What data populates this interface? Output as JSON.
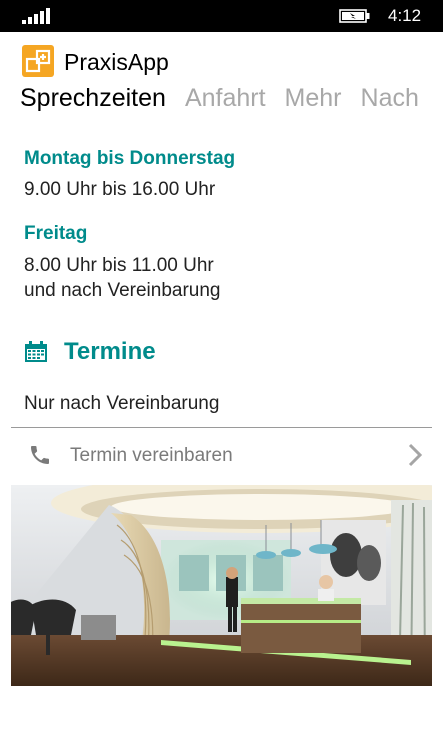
{
  "status_bar": {
    "time": "4:12",
    "signal_icon": "signal-strength-icon",
    "battery_icon": "battery-charging-icon"
  },
  "app": {
    "title": "PraxisApp",
    "logo_icon": "praxis-logo-icon"
  },
  "pivot": {
    "tabs": [
      {
        "label": "Sprechzeiten"
      },
      {
        "label": "Anfahrt"
      },
      {
        "label": "Mehr"
      },
      {
        "label": "Nach"
      }
    ],
    "active_tab": "Sprechzeiten"
  },
  "hours": {
    "mon_thu": {
      "label": "Montag bis Donnerstag",
      "time": "9.00 Uhr bis 16.00 Uhr"
    },
    "fri": {
      "label": "Freitag",
      "time_line1": "8.00 Uhr bis 11.00 Uhr",
      "time_line2": "und nach Vereinbarung"
    }
  },
  "termine": {
    "heading": "Termine",
    "icon": "calendar-icon",
    "text": "Nur nach Vereinbarung"
  },
  "action": {
    "label": "Termin vereinbaren",
    "icon": "phone-icon",
    "chevron_icon": "chevron-right-icon"
  },
  "colors": {
    "accent": "#008b8b",
    "logo": "#f5a623",
    "inactive_tab": "#a8a8a8",
    "status_bar": "#000000"
  }
}
